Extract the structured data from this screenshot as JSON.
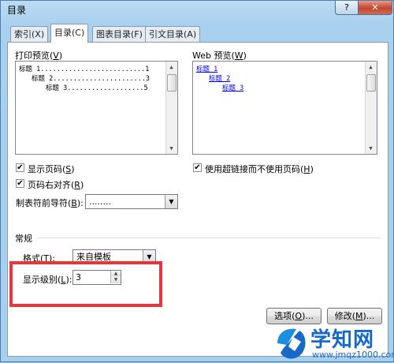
{
  "window": {
    "title": "目录",
    "help": "?",
    "close": "✕"
  },
  "tabs": [
    {
      "label": "索引(X)",
      "active": false
    },
    {
      "label": "目录(C)",
      "active": true
    },
    {
      "label": "图表目录(F)",
      "active": false
    },
    {
      "label": "引文目录(A)",
      "active": false
    }
  ],
  "print_preview": {
    "label": "打印预览",
    "key": "V",
    "lines": [
      "标题 1..........................1",
      "标题 2.......................3",
      "标题 3...................5"
    ]
  },
  "web_preview": {
    "label": "Web 预览",
    "key": "W",
    "links": [
      "标题 1",
      "标题 2",
      "标题 3"
    ]
  },
  "options": {
    "show_page_numbers": {
      "label": "显示页码",
      "key": "S",
      "checked": true
    },
    "right_align": {
      "label": "页码右对齐",
      "key": "R",
      "checked": true
    },
    "tab_leader": {
      "label": "制表符前导符",
      "key": "B",
      "value": "........"
    },
    "use_hyperlinks": {
      "label": "使用超链接而不使用页码",
      "key": "H",
      "checked": true
    }
  },
  "general": {
    "heading": "常规",
    "format": {
      "label": "格式",
      "key": "T",
      "value": "来自模板"
    },
    "levels": {
      "label": "显示级别",
      "key": "L",
      "value": "3"
    }
  },
  "buttons": {
    "options": {
      "label": "选项",
      "key": "O"
    },
    "modify": {
      "label": "修改",
      "key": "M"
    }
  },
  "watermark": {
    "title": "学知网",
    "url": "www.jmqz1000.com"
  }
}
